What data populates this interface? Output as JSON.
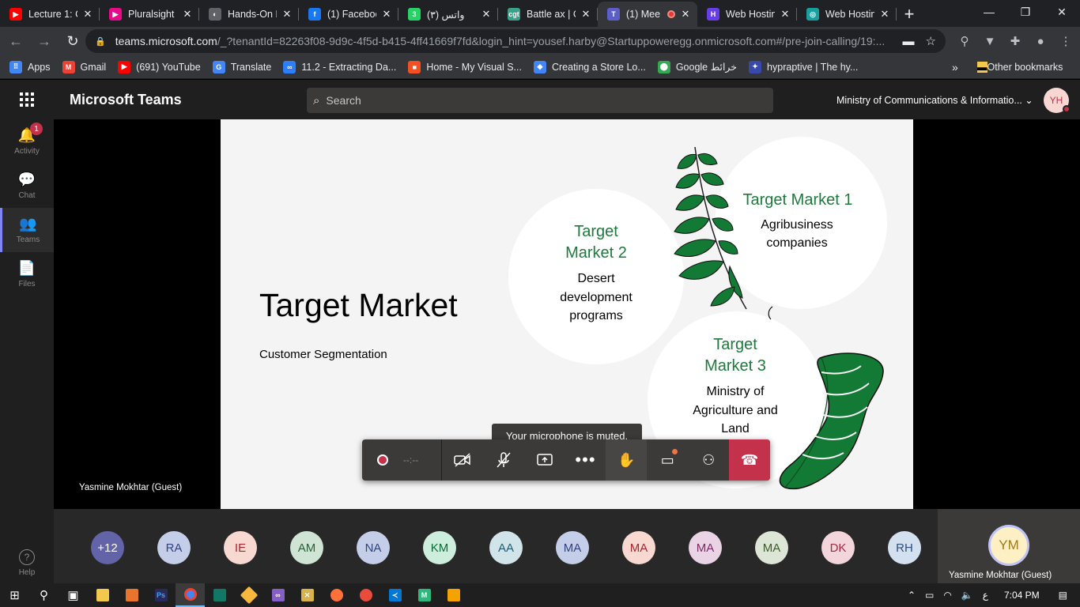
{
  "browser": {
    "tabs": [
      {
        "title": "Lecture 1: C",
        "favicon_color": "#ff0000",
        "favicon_glyph": "▶",
        "active": false,
        "recording": false
      },
      {
        "title": "Pluralsight",
        "favicon_color": "#e80a89",
        "favicon_glyph": "▶",
        "active": false,
        "recording": false
      },
      {
        "title": "Hands-On M",
        "favicon_color": "#5f6368",
        "favicon_glyph": "◐",
        "active": false,
        "recording": false
      },
      {
        "title": "(1) Faceboo",
        "favicon_color": "#1877f2",
        "favicon_glyph": "f",
        "active": false,
        "recording": false
      },
      {
        "title": "(٣) واتس",
        "favicon_color": "#25d366",
        "favicon_glyph": "3",
        "active": false,
        "recording": false
      },
      {
        "title": "Battle ax | C",
        "favicon_color": "#3aa18a",
        "favicon_glyph": "cgt",
        "active": false,
        "recording": false
      },
      {
        "title": "(1) Mee",
        "favicon_color": "#5b5fc7",
        "favicon_glyph": "T",
        "active": true,
        "recording": true
      },
      {
        "title": "Web Hostin",
        "favicon_color": "#673de6",
        "favicon_glyph": "H",
        "active": false,
        "recording": false
      },
      {
        "title": "Web Hostin",
        "favicon_color": "#1a9f9f",
        "favicon_glyph": "◎",
        "active": false,
        "recording": false
      }
    ],
    "url_host": "teams.microsoft.com",
    "url_rest": "/_?tenantId=82263f08-9d9c-4f5d-b415-4ff41669f7fd&login_hint=yousef.harby@Startuppoweregg.onmicrosoft.com#/pre-join-calling/19:...",
    "bookmarks": [
      {
        "label": "Apps",
        "icon_color": "#4285f4",
        "glyph": "⠿"
      },
      {
        "label": "Gmail",
        "icon_color": "#ea4335",
        "glyph": "M"
      },
      {
        "label": "(691) YouTube",
        "icon_color": "#ff0000",
        "glyph": "▶"
      },
      {
        "label": "Translate",
        "icon_color": "#4285f4",
        "glyph": "G"
      },
      {
        "label": "11.2 - Extracting Da...",
        "icon_color": "#2d7ff9",
        "glyph": "∞"
      },
      {
        "label": "Home - My Visual S...",
        "icon_color": "#f25022",
        "glyph": "■"
      },
      {
        "label": "Creating a Store Lo...",
        "icon_color": "#4285f4",
        "glyph": "◆"
      },
      {
        "label": "Google خرائط",
        "icon_color": "#34a853",
        "glyph": "⬤"
      },
      {
        "label": "hypraptive | The hy...",
        "icon_color": "#3949ab",
        "glyph": "✦"
      }
    ],
    "bookmarks_more": "»",
    "other_bookmarks": "Other bookmarks"
  },
  "teams": {
    "app_title": "Microsoft Teams",
    "search_placeholder": "Search",
    "org_name": "Ministry of Communications & Informatio...",
    "user_initials": "YH",
    "rail": [
      {
        "label": "Activity",
        "icon": "bell-icon",
        "glyph": "🔔",
        "badge": "1",
        "active": false
      },
      {
        "label": "Chat",
        "icon": "chat-icon",
        "glyph": "💬",
        "badge": "",
        "active": false
      },
      {
        "label": "Teams",
        "icon": "teams-icon",
        "glyph": "👥",
        "badge": "",
        "active": true
      },
      {
        "label": "Files",
        "icon": "file-icon",
        "glyph": "📄",
        "badge": "",
        "active": false
      }
    ],
    "help_label": "Help"
  },
  "slide": {
    "title": "Target Market",
    "subtitle": "Customer Segmentation",
    "market1_title": "Target Market 1",
    "market1_desc_1": "Agribusiness",
    "market1_desc_2": "companies",
    "market2_title_1": "Target",
    "market2_title_2": "Market 2",
    "market2_desc_1": "Desert",
    "market2_desc_2": "development",
    "market2_desc_3": "programs",
    "market3_title_1": "Target",
    "market3_title_2": "Market 3",
    "market3_desc_1": "Ministry of",
    "market3_desc_2": "Agriculture and",
    "market3_desc_3": "Land",
    "market3_desc_4": "Reclamation",
    "leaf_color": "#137a35"
  },
  "meeting": {
    "presenter_name": "Yasmine Mokhtar (Guest)",
    "mic_tooltip": "Your microphone is muted.",
    "timer": "--:--",
    "participants": [
      {
        "initials": "+12",
        "bg": "#6264a7",
        "fg": "#ffffff"
      },
      {
        "initials": "RA",
        "bg": "#c5cee8",
        "fg": "#30427c"
      },
      {
        "initials": "IE",
        "bg": "#f8d9d2",
        "fg": "#a4262c"
      },
      {
        "initials": "AM",
        "bg": "#cfe4d4",
        "fg": "#29603a"
      },
      {
        "initials": "NA",
        "bg": "#c5cee8",
        "fg": "#30427c"
      },
      {
        "initials": "KM",
        "bg": "#cdeedd",
        "fg": "#0b6a35"
      },
      {
        "initials": "AA",
        "bg": "#d0e4ea",
        "fg": "#205d74"
      },
      {
        "initials": "MA",
        "bg": "#c5cee8",
        "fg": "#30427c"
      },
      {
        "initials": "MA",
        "bg": "#f8d9d2",
        "fg": "#a4262c"
      },
      {
        "initials": "MA",
        "bg": "#ead3e5",
        "fg": "#7c2869"
      },
      {
        "initials": "MA",
        "bg": "#dde5d6",
        "fg": "#3e5a28"
      },
      {
        "initials": "DK",
        "bg": "#f3d6db",
        "fg": "#a32a44"
      },
      {
        "initials": "RH",
        "bg": "#d3e0f0",
        "fg": "#2c4f7c"
      }
    ],
    "self_initials": "YM",
    "self_name": "Yasmine Mokhtar (Guest)"
  },
  "taskbar": {
    "time": "7:04 PM",
    "lang": "ع"
  }
}
